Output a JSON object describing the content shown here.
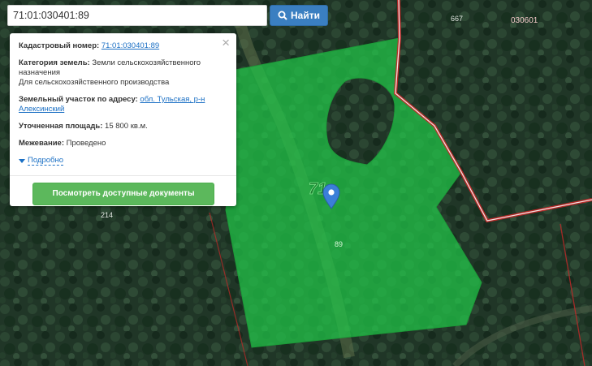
{
  "search": {
    "value": "71:01:030401:89",
    "button_label": "Найти"
  },
  "popup": {
    "cadastral_label": "Кадастровый номер:",
    "cadastral_value": "71:01:030401:89",
    "category_label": "Категория земель:",
    "category_value": "Земли сельскохозяйственного назначения",
    "category_use": "Для сельскохозяйственного производства",
    "address_label": "Земельный участок по адресу:",
    "address_value": "обл. Тульская, р-н Алексинский",
    "area_label": "Уточненная площадь:",
    "area_value": "15 800 кв.м.",
    "survey_label": "Межевание:",
    "survey_value": "Проведено",
    "more_label": "Подробно",
    "docs_button_label": "Посмотреть доступные документы"
  },
  "map": {
    "labels": {
      "block_number": "71",
      "parcel_number": "89",
      "label_667": "667",
      "label_030601": "030601",
      "label_214": "214"
    },
    "colors": {
      "parcel_fill": "#21c84a",
      "boundary": "#d32f2f",
      "marker": "#3b7fd9",
      "forest": "#1c3324"
    },
    "icons": [
      "search-icon",
      "close-icon",
      "map-marker-icon",
      "triangle-down-icon"
    ]
  }
}
